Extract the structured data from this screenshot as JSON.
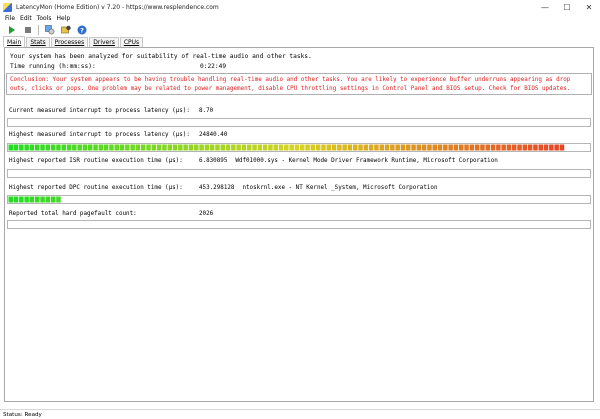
{
  "window": {
    "title": "LatencyMon  (Home Edition)  v 7.20 - https://www.resplendence.com",
    "buttons": [
      "—",
      "☐",
      "✕"
    ]
  },
  "menu": [
    "File",
    "Edit",
    "Tools",
    "Help"
  ],
  "toolbar": {
    "icons": [
      "play-icon",
      "stop-icon",
      "settings-icon",
      "tools-icon",
      "help-icon"
    ]
  },
  "tabs": [
    "Main",
    "Stats",
    "Processes",
    "Drivers",
    "CPUs"
  ],
  "summary": {
    "line1": "Your system has been analyzed for suitability of real-time audio and other tasks.",
    "time_label": "Time running (h:mm:ss):",
    "time_value": "0:22:49"
  },
  "conclusion": "Conclusion: Your system appears to be having trouble handling real-time audio and other tasks. You are likely to experience buffer underruns appearing as drop outs, clicks or pops. One problem may be related to power management, disable CPU throttling settings in Control Panel and BIOS setup. Check for BIOS updates.",
  "metrics": {
    "current_interrupt": {
      "label": "Current measured interrupt to process latency (µs):",
      "value": "8.70",
      "level": 0
    },
    "highest_interrupt": {
      "label": "Highest measured interrupt to process latency (µs):",
      "value": "24840.40",
      "level": 0.964
    },
    "isr": {
      "label": "Highest reported ISR routine execution time (µs):",
      "value": "6.830895",
      "detail": "Wdf01000.sys - Kernel Mode Driver Framework Runtime, Microsoft Corporation",
      "level": 0
    },
    "dpc": {
      "label": "Highest reported DPC routine execution time (µs):",
      "value": "453.298128",
      "detail": "ntoskrnl.exe - NT Kernel _System, Microsoft Corporation",
      "level": 0.088
    },
    "pagefault": {
      "label": "Reported total hard pagefault count:",
      "value": "2026"
    }
  },
  "colors": {
    "conclusion_text": "#e02020",
    "bar_start": "#22dd22",
    "bar_mid": "#d7d222",
    "bar_end": "#e83a25"
  },
  "status": "Status: Ready"
}
